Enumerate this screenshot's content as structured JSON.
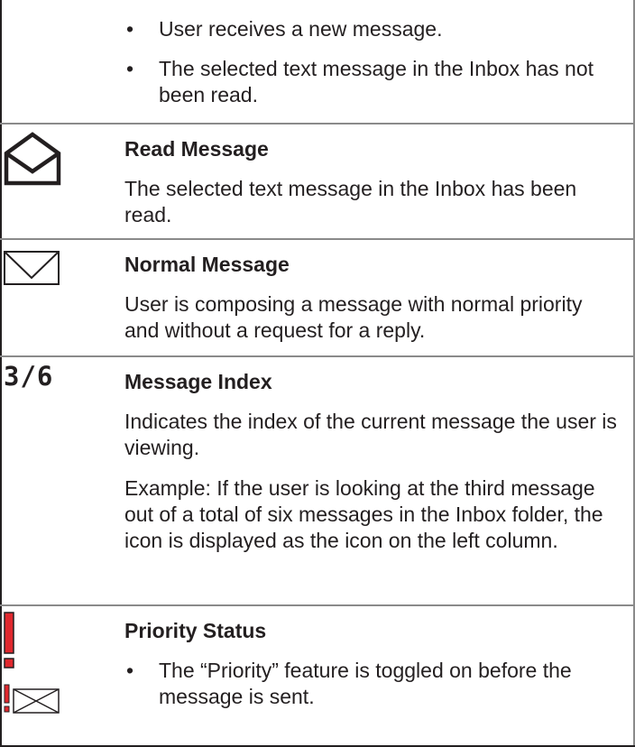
{
  "rows": [
    {
      "bullets": [
        "User receives a new message.",
        "The selected text message in the Inbox has not been read."
      ]
    },
    {
      "icon": "read-message-envelope-icon",
      "title": "Read Message",
      "paragraphs": [
        "The selected text message in the Inbox has been read."
      ]
    },
    {
      "icon": "normal-message-envelope-icon",
      "title": "Normal Message",
      "paragraphs": [
        "User is composing a message with normal priority and without a request for a reply."
      ]
    },
    {
      "icon_text": "3/6",
      "title": "Message Index",
      "paragraphs": [
        "Indicates the index of the current message the user is viewing.",
        "Example: If the user is looking at the third message out of a total of six messages in the Inbox folder, the icon is displayed as the icon on the left column."
      ]
    },
    {
      "icons": [
        "priority-exclamation-icon",
        "priority-envelope-icon"
      ],
      "title": "Priority Status",
      "bullets": [
        "The “Priority” feature is toggled on before the message is sent."
      ]
    }
  ],
  "colors": {
    "text": "#231f20",
    "rule": "#8a8a8a",
    "priority_red": "#e0282e"
  }
}
